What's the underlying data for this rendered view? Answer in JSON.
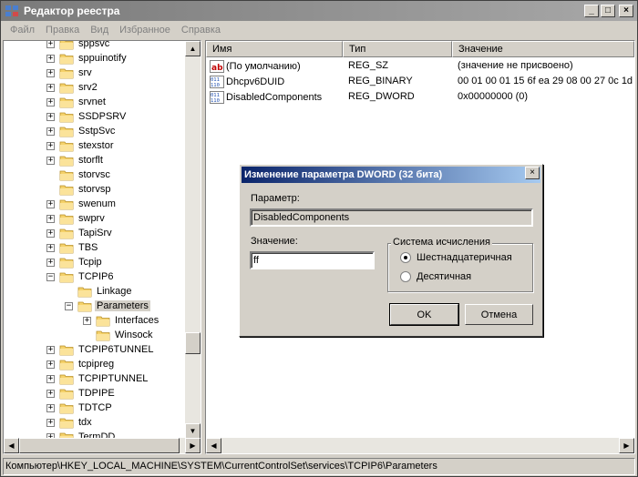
{
  "window": {
    "title": "Редактор реестра",
    "controls": [
      "_",
      "□",
      "×"
    ]
  },
  "menu": [
    "Файл",
    "Правка",
    "Вид",
    "Избранное",
    "Справка"
  ],
  "tree": [
    {
      "label": "sppsvc",
      "depth": 0,
      "expander": "+"
    },
    {
      "label": "sppuinotify",
      "depth": 0,
      "expander": "+"
    },
    {
      "label": "srv",
      "depth": 0,
      "expander": "+"
    },
    {
      "label": "srv2",
      "depth": 0,
      "expander": "+"
    },
    {
      "label": "srvnet",
      "depth": 0,
      "expander": "+"
    },
    {
      "label": "SSDPSRV",
      "depth": 0,
      "expander": "+"
    },
    {
      "label": "SstpSvc",
      "depth": 0,
      "expander": "+"
    },
    {
      "label": "stexstor",
      "depth": 0,
      "expander": "+"
    },
    {
      "label": "storflt",
      "depth": 0,
      "expander": "+"
    },
    {
      "label": "storvsc",
      "depth": 0,
      "expander": ""
    },
    {
      "label": "storvsp",
      "depth": 0,
      "expander": ""
    },
    {
      "label": "swenum",
      "depth": 0,
      "expander": "+"
    },
    {
      "label": "swprv",
      "depth": 0,
      "expander": "+"
    },
    {
      "label": "TapiSrv",
      "depth": 0,
      "expander": "+"
    },
    {
      "label": "TBS",
      "depth": 0,
      "expander": "+"
    },
    {
      "label": "Tcpip",
      "depth": 0,
      "expander": "+"
    },
    {
      "label": "TCPIP6",
      "depth": 0,
      "expander": "-"
    },
    {
      "label": "Linkage",
      "depth": 1,
      "expander": ""
    },
    {
      "label": "Parameters",
      "depth": 1,
      "expander": "-",
      "selected": true
    },
    {
      "label": "Interfaces",
      "depth": 2,
      "expander": "+"
    },
    {
      "label": "Winsock",
      "depth": 2,
      "expander": ""
    },
    {
      "label": "TCPIP6TUNNEL",
      "depth": 0,
      "expander": "+"
    },
    {
      "label": "tcpipreg",
      "depth": 0,
      "expander": "+"
    },
    {
      "label": "TCPIPTUNNEL",
      "depth": 0,
      "expander": "+"
    },
    {
      "label": "TDPIPE",
      "depth": 0,
      "expander": "+"
    },
    {
      "label": "TDTCP",
      "depth": 0,
      "expander": "+"
    },
    {
      "label": "tdx",
      "depth": 0,
      "expander": "+"
    },
    {
      "label": "TermDD",
      "depth": 0,
      "expander": "+"
    }
  ],
  "columns": {
    "name": "Имя",
    "type": "Тип",
    "value": "Значение"
  },
  "values": [
    {
      "icon": "string-value-icon",
      "name": "(По умолчанию)",
      "type": "REG_SZ",
      "data": "(значение не присвоено)"
    },
    {
      "icon": "binary-value-icon",
      "name": "Dhcpv6DUID",
      "type": "REG_BINARY",
      "data": "00 01 00 01 15 6f ea 29 08 00 27 0c 1d"
    },
    {
      "icon": "binary-value-icon",
      "name": "DisabledComponents",
      "type": "REG_DWORD",
      "data": "0x00000000 (0)"
    }
  ],
  "status": "Компьютер\\HKEY_LOCAL_MACHINE\\SYSTEM\\CurrentControlSet\\services\\TCPIP6\\Parameters",
  "dialog": {
    "title": "Изменение параметра DWORD (32 бита)",
    "close": "×",
    "param_label": "Параметр:",
    "param_value": "DisabledComponents",
    "value_label": "Значение:",
    "value_input": "ff",
    "base_group": "Система исчисления",
    "radio_hex": "Шестнадцатеричная",
    "radio_dec": "Десятичная",
    "ok": "OK",
    "cancel": "Отмена"
  },
  "colors": {
    "title_active": "#0a246a",
    "title_inactive": "#7a7a7a",
    "folder": "#f5d26b"
  }
}
